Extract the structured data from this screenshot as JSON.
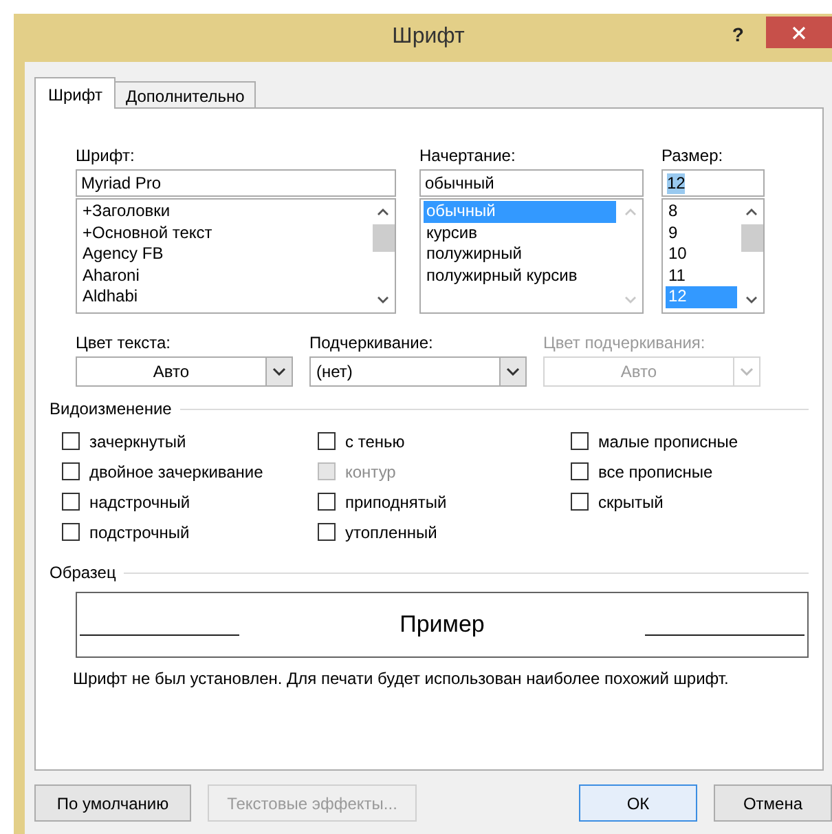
{
  "window": {
    "title": "Шрифт",
    "help": "?"
  },
  "tabs": [
    {
      "label": "Шрифт",
      "selected": true
    },
    {
      "label": "Дополнительно",
      "selected": false
    }
  ],
  "font": {
    "label": "Шрифт:",
    "value": "Myriad Pro",
    "value_selected": false,
    "scroll_enabled": true,
    "items": [
      {
        "text": "+Заголовки",
        "selected": false
      },
      {
        "text": "+Основной текст",
        "selected": false
      },
      {
        "text": "Agency FB",
        "selected": false
      },
      {
        "text": "Aharoni",
        "selected": false
      },
      {
        "text": "Aldhabi",
        "selected": false
      }
    ]
  },
  "style": {
    "label": "Начертание:",
    "value": "обычный",
    "value_selected": false,
    "scroll_enabled": false,
    "items": [
      {
        "text": "обычный",
        "selected": true
      },
      {
        "text": "курсив",
        "selected": false
      },
      {
        "text": "полужирный",
        "selected": false
      },
      {
        "text": "полужирный курсив",
        "selected": false
      }
    ]
  },
  "size": {
    "label": "Размер:",
    "value": "12",
    "value_selected": true,
    "scroll_enabled": true,
    "items": [
      {
        "text": "8",
        "selected": false
      },
      {
        "text": "9",
        "selected": false
      },
      {
        "text": "10",
        "selected": false
      },
      {
        "text": "11",
        "selected": false
      },
      {
        "text": "12",
        "selected": true
      }
    ]
  },
  "dropdowns": [
    {
      "label": "Цвет текста:",
      "value": "Авто",
      "centered": true,
      "disabled": false
    },
    {
      "label": "Подчеркивание:",
      "value": "(нет)",
      "centered": false,
      "disabled": false
    },
    {
      "label": "Цвет подчеркивания:",
      "value": "Авто",
      "centered": true,
      "disabled": true
    }
  ],
  "effects": {
    "title": "Видоизменение",
    "columns": [
      [
        {
          "label": "зачеркнутый",
          "checked": false,
          "disabled": false
        },
        {
          "label": "двойное зачеркивание",
          "checked": false,
          "disabled": false
        },
        {
          "label": "надстрочный",
          "checked": false,
          "disabled": false
        },
        {
          "label": "подстрочный",
          "checked": false,
          "disabled": false
        }
      ],
      [
        {
          "label": "с тенью",
          "checked": false,
          "disabled": false
        },
        {
          "label": "контур",
          "checked": false,
          "disabled": true
        },
        {
          "label": "приподнятый",
          "checked": false,
          "disabled": false
        },
        {
          "label": "утопленный",
          "checked": false,
          "disabled": false
        }
      ],
      [
        {
          "label": "малые прописные",
          "checked": false,
          "disabled": false
        },
        {
          "label": "все прописные",
          "checked": false,
          "disabled": false
        },
        {
          "label": "скрытый",
          "checked": false,
          "disabled": false
        }
      ]
    ]
  },
  "preview": {
    "title": "Образец",
    "sample": "Пример",
    "note": "Шрифт не был установлен. Для печати будет использован наиболее похожий шрифт."
  },
  "buttons_left": [
    {
      "label": "По умолчанию",
      "disabled": false,
      "default": false
    },
    {
      "label": "Текстовые эффекты...",
      "disabled": true,
      "default": false
    }
  ],
  "buttons_right": [
    {
      "label": "ОК",
      "disabled": false,
      "default": true
    },
    {
      "label": "Отмена",
      "disabled": false,
      "default": false
    }
  ]
}
